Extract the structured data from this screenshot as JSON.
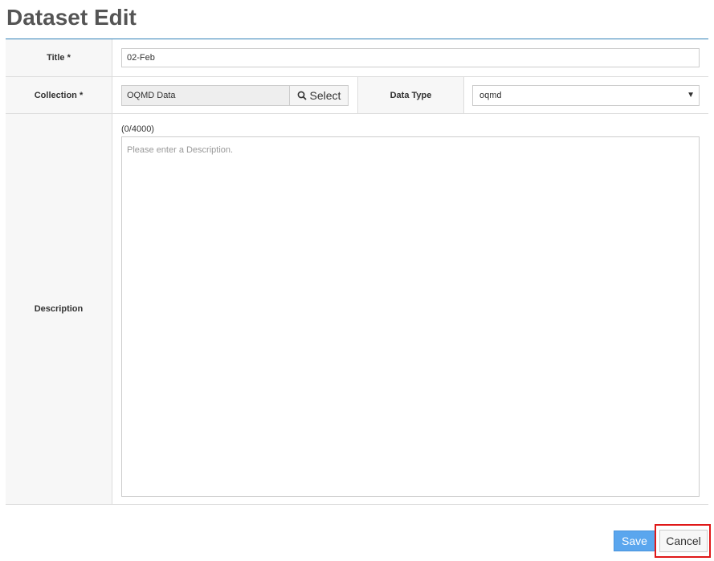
{
  "page": {
    "title": "Dataset Edit"
  },
  "form": {
    "title_label": "Title *",
    "title_value": "02-Feb",
    "collection_label": "Collection *",
    "collection_value": "OQMD Data",
    "select_label": "Select",
    "data_type_label": "Data Type",
    "data_type_value": "oqmd",
    "description_label": "Description",
    "description_counter": "(0/4000)",
    "description_placeholder": "Please enter a Description."
  },
  "actions": {
    "save_label": "Save",
    "cancel_label": "Cancel"
  },
  "icons": {
    "select": "search-icon",
    "dropdown": "caret-down-icon"
  },
  "colors": {
    "accent": "#2f7fb6",
    "save": "#5aa6ee",
    "highlight": "#e01818"
  }
}
